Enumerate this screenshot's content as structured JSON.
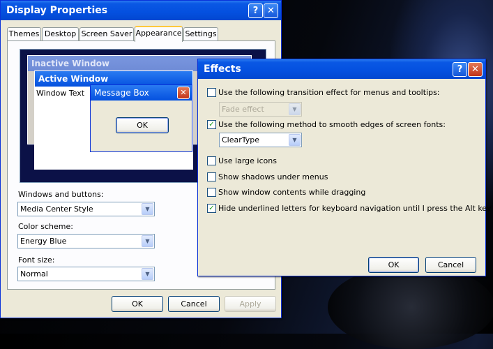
{
  "display_properties": {
    "title": "Display Properties",
    "help_button": "?",
    "close_button": "✕",
    "tabs": [
      {
        "label": "Themes"
      },
      {
        "label": "Desktop"
      },
      {
        "label": "Screen Saver"
      },
      {
        "label": "Appearance"
      },
      {
        "label": "Settings"
      }
    ],
    "preview": {
      "inactive_title": "Inactive Window",
      "active_title": "Active Window",
      "window_text": "Window Text",
      "message_box_title": "Message Box",
      "message_box_ok": "OK"
    },
    "windows_buttons_label": "Windows and buttons:",
    "windows_buttons_value": "Media Center Style",
    "color_scheme_label": "Color scheme:",
    "color_scheme_value": "Energy Blue",
    "font_size_label": "Font size:",
    "font_size_value": "Normal",
    "ok_label": "OK",
    "cancel_label": "Cancel",
    "apply_label": "Apply"
  },
  "effects": {
    "title": "Effects",
    "help_button": "?",
    "close_button": "✕",
    "options": {
      "transition": {
        "label": "Use the following transition effect for menus and tooltips:",
        "checked": false,
        "value": "Fade effect"
      },
      "smooth_fonts": {
        "label": "Use the following method to smooth edges of screen fonts:",
        "checked": true,
        "value": "ClearType"
      },
      "large_icons": {
        "label": "Use large icons",
        "checked": false
      },
      "shadows": {
        "label": "Show shadows under menus",
        "checked": false
      },
      "drag_contents": {
        "label": "Show window contents while dragging",
        "checked": false
      },
      "hide_underlines": {
        "label": "Hide underlined letters for keyboard navigation until I press the Alt key",
        "checked": true
      }
    },
    "ok_label": "OK",
    "cancel_label": "Cancel"
  },
  "colors": {
    "title_bar": "#0450df",
    "dialog_bg": "#ece9d8",
    "preview_bg": "#0b1147",
    "check_mark": "#21a121"
  }
}
